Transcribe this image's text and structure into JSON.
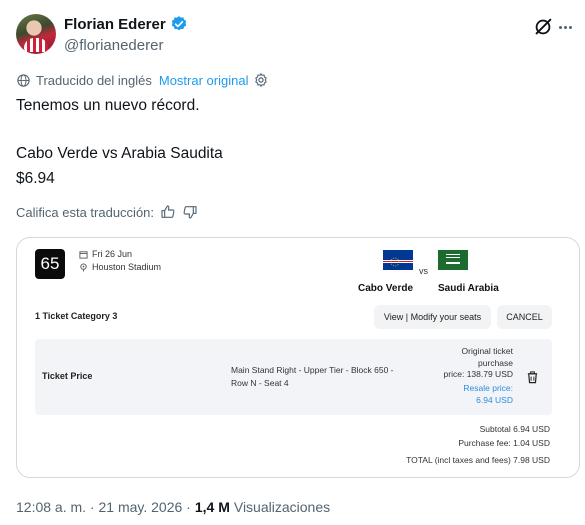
{
  "author": {
    "display_name": "Florian Ederer",
    "handle": "@florianederer"
  },
  "translation": {
    "label": "Traducido del inglés",
    "show_original": "Mostrar original"
  },
  "tweet": {
    "line1": "Tenemos un nuevo récord.",
    "line2": "Cabo Verde vs Arabia Saudita",
    "line3": "$6.94"
  },
  "rate_label": "Califica esta traducción:",
  "card": {
    "number": "65",
    "date": "Fri 26 Jun",
    "venue": "Houston Stadium",
    "vs": "vs",
    "home_team": "Cabo Verde",
    "away_team": "Saudi Arabia",
    "ticket_category": "1 Ticket Category 3",
    "view_button": "View | Modify your seats",
    "cancel_button": "CANCEL",
    "ticket_price_label": "Ticket Price",
    "seat_line1": "Main Stand Right - Upper Tier - Block 650 -",
    "seat_line2": "Row N - Seat 4",
    "original_line1": "Original ticket",
    "original_line2": "purchase",
    "original_line3": "price: 138.79 USD",
    "resale_line1": "Resale price:",
    "resale_line2": "6.94 USD",
    "subtotal": "Subtotal 6.94 USD",
    "purchase_fee": "Purchase fee: 1.04 USD",
    "total": "TOTAL (incl taxes and fees) 7.98 USD"
  },
  "meta": {
    "timestamp": "12:08 a. m. · 21 may. 2026 ·",
    "views_count": "1,4 M",
    "views_label": "Visualizaciones"
  },
  "colors": {
    "link": "#1d9bf0",
    "verified": "#1d9bf0",
    "resale": "#2b8ce0"
  }
}
